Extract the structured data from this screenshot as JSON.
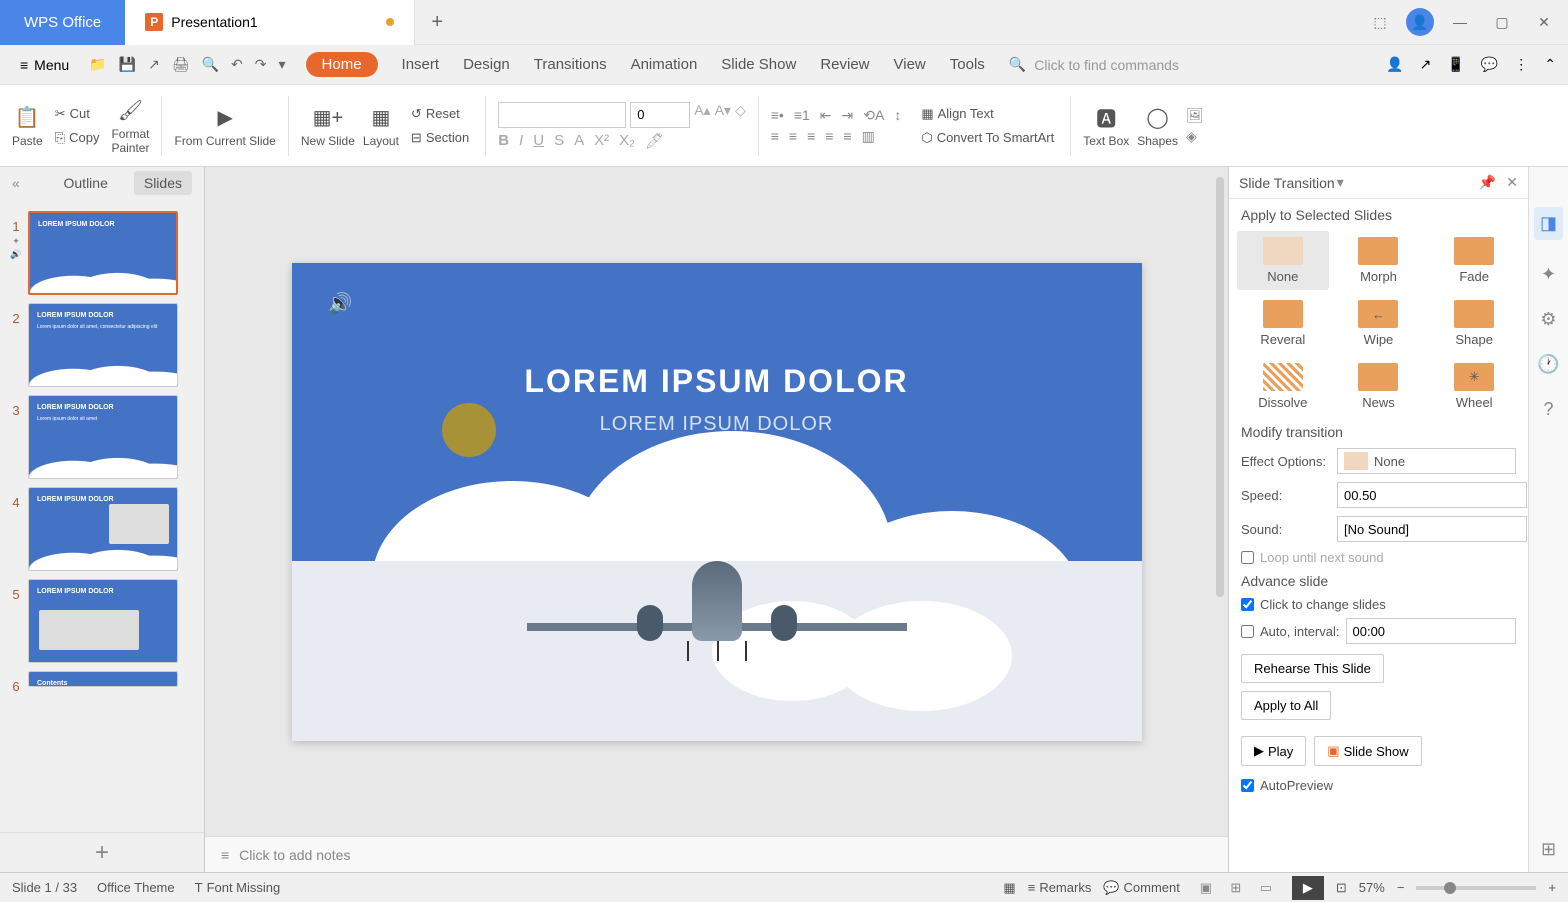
{
  "titlebar": {
    "app_name": "WPS Office",
    "doc_name": "Presentation1",
    "add_tab": "+"
  },
  "menubar": {
    "menu_label": "Menu",
    "tabs": [
      "Home",
      "Insert",
      "Design",
      "Transitions",
      "Animation",
      "Slide Show",
      "Review",
      "View",
      "Tools"
    ],
    "search_placeholder": "Click to find commands"
  },
  "ribbon": {
    "paste": "Paste",
    "cut": "Cut",
    "copy": "Copy",
    "format_painter": "Format\nPainter",
    "from_current": "From Current Slide",
    "new_slide": "New Slide",
    "layout": "Layout",
    "reset": "Reset",
    "section": "Section",
    "font_size": "0",
    "align_text": "Align Text",
    "convert_smartart": "Convert To SmartArt",
    "text_box": "Text Box",
    "shapes": "Shapes"
  },
  "slidepanel": {
    "outline": "Outline",
    "slides": "Slides",
    "thumbs": [
      {
        "num": "1",
        "title": "LOREM IPSUM DOLOR"
      },
      {
        "num": "2",
        "title": "LOREM IPSUM DOLOR"
      },
      {
        "num": "3",
        "title": "LOREM IPSUM DOLOR"
      },
      {
        "num": "4",
        "title": "LOREM IPSUM DOLOR"
      },
      {
        "num": "5",
        "title": "LOREM IPSUM DOLOR"
      },
      {
        "num": "6",
        "title": "Contents"
      }
    ]
  },
  "canvas": {
    "title": "LOREM IPSUM DOLOR",
    "subtitle": "LOREM IPSUM DOLOR"
  },
  "notes": {
    "placeholder": "Click to add notes"
  },
  "transition_pane": {
    "title": "Slide Transition",
    "apply_label": "Apply to Selected Slides",
    "transitions": [
      "None",
      "Morph",
      "Fade",
      "Reveral",
      "Wipe",
      "Shape",
      "Dissolve",
      "News",
      "Wheel"
    ],
    "modify_label": "Modify transition",
    "effect_options_label": "Effect Options:",
    "effect_options_value": "None",
    "speed_label": "Speed:",
    "speed_value": "00.50",
    "sound_label": "Sound:",
    "sound_value": "[No Sound]",
    "loop_label": "Loop until next sound",
    "advance_label": "Advance slide",
    "click_change": "Click to change slides",
    "auto_interval_label": "Auto, interval:",
    "auto_interval_value": "00:00",
    "rehearse": "Rehearse This Slide",
    "apply_all": "Apply to All",
    "play": "Play",
    "slide_show": "Slide Show",
    "autopreview": "AutoPreview"
  },
  "statusbar": {
    "slide_count": "Slide 1 / 33",
    "theme": "Office Theme",
    "font_missing": "Font Missing",
    "remarks": "Remarks",
    "comment": "Comment",
    "zoom": "57%"
  }
}
